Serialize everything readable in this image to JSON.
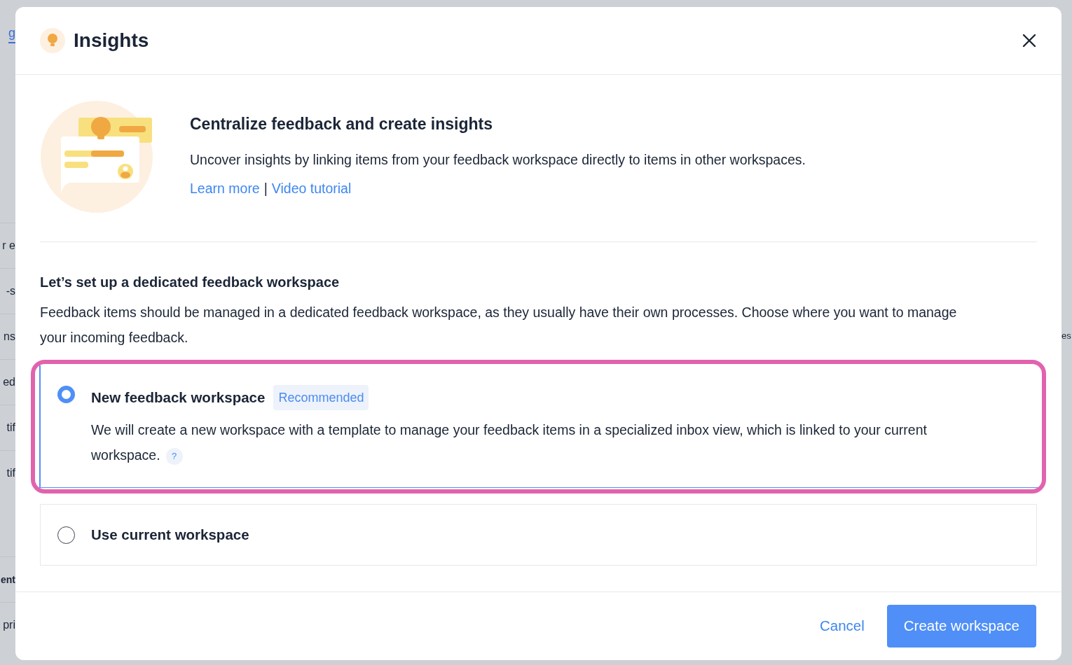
{
  "background": {
    "left_fragments": [
      {
        "text": "g",
        "kind": "tab"
      },
      {
        "text": "r e",
        "kind": "row"
      },
      {
        "text": "-s",
        "kind": "row"
      },
      {
        "text": "ns",
        "kind": "row"
      },
      {
        "text": "ed",
        "kind": "row"
      },
      {
        "text": "tif",
        "kind": "row"
      },
      {
        "text": "tif",
        "kind": "row"
      },
      {
        "text": "ent",
        "kind": "heading"
      },
      {
        "text": "pri",
        "kind": "row"
      }
    ],
    "right_fragments": [
      "es"
    ]
  },
  "dialog": {
    "title": "Insights",
    "intro": {
      "heading": "Centralize feedback and create insights",
      "text": "Uncover insights by linking items from your feedback workspace directly to items in other workspaces.",
      "links": [
        "Learn more",
        "Video tutorial"
      ],
      "separator": "|"
    },
    "section": {
      "title": "Let’s set up a dedicated feedback workspace",
      "text": "Feedback items should be managed in a dedicated feedback workspace, as they usually have their own processes. Choose where you want to manage your incoming feedback."
    },
    "options": [
      {
        "title": "New feedback workspace",
        "badge": "Recommended",
        "text": "We will create a new workspace with a template to manage your feedback items in a specialized inbox view, which is linked to your current workspace.",
        "help": "?",
        "selected": true,
        "highlighted": true
      },
      {
        "title": "Use current workspace",
        "selected": false,
        "highlighted": false
      }
    ],
    "buttons": [
      {
        "label": "Cancel",
        "kind": "secondary"
      },
      {
        "label": "Create workspace",
        "kind": "primary"
      }
    ]
  }
}
